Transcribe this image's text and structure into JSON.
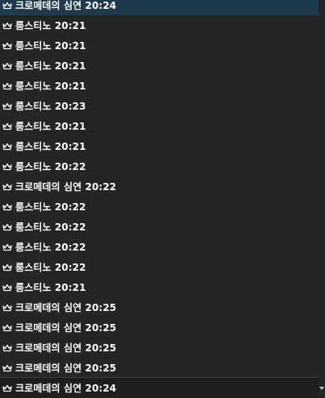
{
  "icon": "crown-icon",
  "rows": [
    {
      "text": "크로메데의 심연 20:24",
      "highlight": true
    },
    {
      "text": "룸스티노 20:21"
    },
    {
      "text": "룸스티노 20:21"
    },
    {
      "text": "룸스티노 20:21"
    },
    {
      "text": "룸스티노 20:21"
    },
    {
      "text": "룸스티노 20:23"
    },
    {
      "text": "룸스티노 20:21"
    },
    {
      "text": "룸스티노 20:21"
    },
    {
      "text": "룸스티노 20:22"
    },
    {
      "text": "크로메데의 심연 20:22"
    },
    {
      "text": "룸스티노 20:22"
    },
    {
      "text": "룸스티노 20:22"
    },
    {
      "text": "룸스티노 20:22"
    },
    {
      "text": "룸스티노 20:22"
    },
    {
      "text": "룸스티노 20:21"
    },
    {
      "text": "크로메데의 심연 20:25"
    },
    {
      "text": "크로메데의 심연 20:25"
    },
    {
      "text": "크로메데의 심연 20:25"
    },
    {
      "text": "크로메데의 심연 20:25"
    }
  ],
  "footer": {
    "text": "크로메데의 심연 20:24"
  },
  "colors": {
    "background": "#252526",
    "highlight": "#1f3a4a",
    "text": "#ffffff"
  }
}
